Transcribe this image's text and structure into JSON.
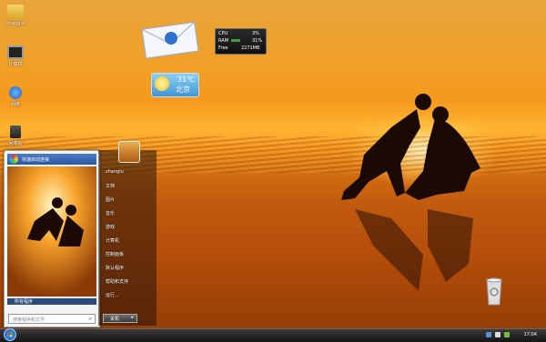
{
  "desktop": {
    "icons": [
      {
        "label": "zhanglu",
        "icon": "folder-icon"
      },
      {
        "label": "计算机",
        "icon": "computer-icon"
      },
      {
        "label": "网络",
        "icon": "network-icon"
      },
      {
        "label": "回收站",
        "icon": "recycle-bin-icon"
      }
    ]
  },
  "gadgets": {
    "cpu": {
      "cpu_label": "CPU",
      "cpu_value": "3%",
      "ram_label": "RAM",
      "ram_value": "31%",
      "free_label": "Free",
      "free_value": "2271MB"
    },
    "weather": {
      "temp": "31℃",
      "city": "北京"
    }
  },
  "start_menu": {
    "top_program": "快速启动连接",
    "search_placeholder": "搜索程序和文件",
    "all_programs": "所有程序",
    "right_items": [
      "zhanglu",
      "文档",
      "图片",
      "音乐",
      "游戏",
      "计算机",
      "控制面板",
      "默认程序",
      "帮助和支持",
      "运行..."
    ],
    "shutdown_label": "关机"
  },
  "taskbar": {
    "time": "17:04"
  },
  "colors": {
    "accent": "#f59a1c",
    "taskbar": "#1c1c1c"
  }
}
